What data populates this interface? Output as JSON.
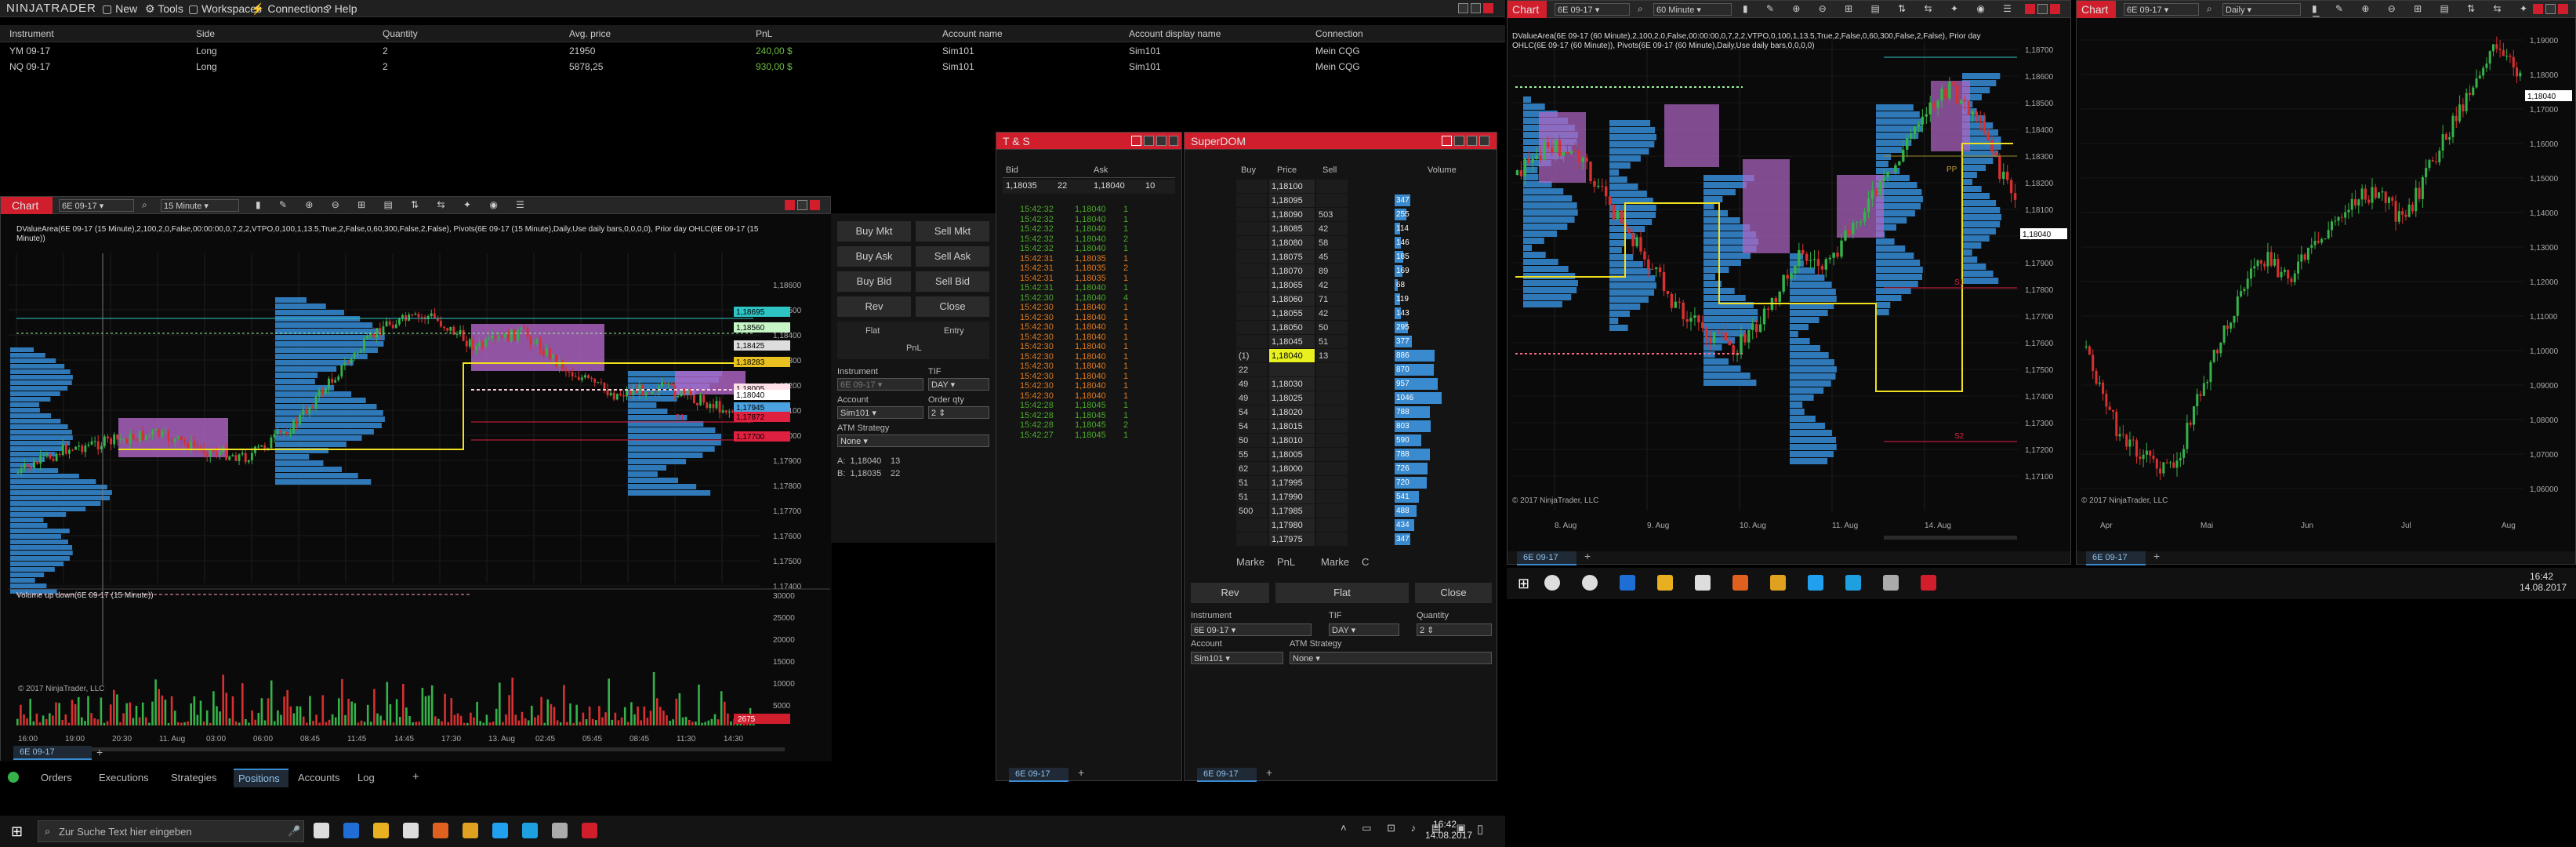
{
  "menu": {
    "logo": "NINJATRADER",
    "items": [
      "New",
      "Tools",
      "Workspaces",
      "Connections",
      "Help"
    ]
  },
  "positions": {
    "columns": [
      "Instrument",
      "Side",
      "Quantity",
      "Avg. price",
      "PnL",
      "Account name",
      "Account display name",
      "Connection"
    ],
    "rows": [
      [
        "YM 09-17",
        "Long",
        "2",
        "21950",
        "240,00 $",
        "Sim101",
        "Sim101",
        "Mein CQG"
      ],
      [
        "NQ 09-17",
        "Long",
        "2",
        "5878,25",
        "930,00 $",
        "Sim101",
        "Sim101",
        "Mein CQG"
      ]
    ]
  },
  "chart1": {
    "title": "Chart",
    "instrument": "6E 09-17",
    "interval": "15 Minute",
    "indicator_text": "DValueArea(6E 09-17 (15 Minute),2,100,2,0,False,00:00:00,0,7,2,2,VTPO,0,100,1,13.5,True,2,False,0,60,300,False,2,False), Pivots(6E 09-17 (15 Minute),Daily,Use daily bars,0,0,0,0), Prior day OHLC(6E 09-17 (15 Minute))",
    "price_ticks": [
      "1,18600",
      "1,18500",
      "1,18400",
      "1,18300",
      "1,18200",
      "1,18100",
      "1,18000",
      "1,17900",
      "1,17800",
      "1,17700",
      "1,17600",
      "1,17500",
      "1,17400"
    ],
    "price_labels": [
      {
        "text": "1,18695",
        "color": "#2ec4c4"
      },
      {
        "text": "1,18560",
        "color": "#c6f6c6"
      },
      {
        "text": "1,18425",
        "color": "#dddddd"
      },
      {
        "text": "1,18283",
        "color": "#e8c020"
      },
      {
        "text": "1,18005",
        "color": "#ffe0e8"
      },
      {
        "text": "1,18040",
        "color": "#ffffff"
      },
      {
        "text": "1,17945",
        "color": "#4aa3e0"
      },
      {
        "text": "1,17872",
        "color": "#e02040"
      },
      {
        "text": "1,17700",
        "color": "#e02040"
      }
    ],
    "time_ticks": [
      "16:00",
      "19:00",
      "20:30",
      "11. Aug",
      "03:00",
      "06:00",
      "08:45",
      "11:45",
      "14:45",
      "17:30",
      "13. Aug",
      "02:45",
      "05:45",
      "08:45",
      "11:30",
      "14:30"
    ],
    "volume_title": "Volume up down(6E 09-17 (15 Minute))",
    "volume_ticks": [
      "30000",
      "25000",
      "20000",
      "15000",
      "10000",
      "5000"
    ],
    "volume_label": "2675",
    "copyright": "© 2017 NinjaTrader, LLC",
    "tab": "6E 09-17",
    "markers": {
      "s1": "S1"
    }
  },
  "order_panel": {
    "buy_mkt": "Buy Mkt",
    "sell_mkt": "Sell Mkt",
    "buy_ask": "Buy Ask",
    "sell_ask": "Sell Ask",
    "buy_bid": "Buy Bid",
    "sell_bid": "Sell Bid",
    "rev": "Rev",
    "close": "Close",
    "flat": "Flat",
    "entry": "Entry",
    "pnl": "PnL",
    "instrument_label": "Instrument",
    "instrument_value": "6E 09-17",
    "tif_label": "TIF",
    "tif_value": "DAY",
    "account_label": "Account",
    "account_value": "Sim101",
    "order_qty_label": "Order qty",
    "order_qty_value": "2",
    "atm_label": "ATM Strategy",
    "atm_value": "None",
    "ask_label": "A:",
    "ask_price": "1,18040",
    "ask_size": "13",
    "bid_label": "B:",
    "bid_price": "1,18035",
    "bid_size": "22"
  },
  "ts": {
    "title": "T & S",
    "bid_label": "Bid",
    "ask_label": "Ask",
    "bid_price": "1,18035",
    "bid_size": "22",
    "ask_price": "1,18040",
    "ask_size": "10",
    "rows": [
      [
        "15:42:32",
        "1,18040",
        "1",
        "g"
      ],
      [
        "15:42:32",
        "1,18040",
        "1",
        "g"
      ],
      [
        "15:42:32",
        "1,18040",
        "1",
        "g"
      ],
      [
        "15:42:32",
        "1,18040",
        "2",
        "g"
      ],
      [
        "15:42:32",
        "1,18040",
        "1",
        "g"
      ],
      [
        "15:42:31",
        "1,18035",
        "1",
        "r"
      ],
      [
        "15:42:31",
        "1,18035",
        "2",
        "r"
      ],
      [
        "15:42:31",
        "1,18035",
        "1",
        "r"
      ],
      [
        "15:42:31",
        "1,18040",
        "1",
        "g"
      ],
      [
        "15:42:30",
        "1,18040",
        "4",
        "g"
      ],
      [
        "15:42:30",
        "1,18040",
        "1",
        "r"
      ],
      [
        "15:42:30",
        "1,18040",
        "1",
        "r"
      ],
      [
        "15:42:30",
        "1,18040",
        "1",
        "r"
      ],
      [
        "15:42:30",
        "1,18040",
        "1",
        "r"
      ],
      [
        "15:42:30",
        "1,18040",
        "1",
        "r"
      ],
      [
        "15:42:30",
        "1,18040",
        "1",
        "r"
      ],
      [
        "15:42:30",
        "1,18040",
        "1",
        "r"
      ],
      [
        "15:42:30",
        "1,18040",
        "1",
        "r"
      ],
      [
        "15:42:30",
        "1,18040",
        "1",
        "r"
      ],
      [
        "15:42:30",
        "1,18040",
        "1",
        "r"
      ],
      [
        "15:42:28",
        "1,18045",
        "1",
        "g"
      ],
      [
        "15:42:28",
        "1,18045",
        "1",
        "g"
      ],
      [
        "15:42:28",
        "1,18045",
        "2",
        "g"
      ],
      [
        "15:42:27",
        "1,18045",
        "1",
        "g"
      ]
    ],
    "tab": "6E 09-17"
  },
  "dom": {
    "title": "SuperDOM",
    "col_buy": "Buy",
    "col_price": "Price",
    "col_sell": "Sell",
    "col_volume": "Volume",
    "rows": [
      [
        "",
        "1,18100",
        "",
        ""
      ],
      [
        "",
        "1,18095",
        "",
        "347"
      ],
      [
        "",
        "1,18090",
        "503",
        "255"
      ],
      [
        "",
        "1,18085",
        "42",
        "114"
      ],
      [
        "",
        "1,18080",
        "58",
        "146"
      ],
      [
        "",
        "1,18075",
        "45",
        "185"
      ],
      [
        "",
        "1,18070",
        "89",
        "169"
      ],
      [
        "",
        "1,18065",
        "42",
        "68"
      ],
      [
        "",
        "1,18060",
        "71",
        "119"
      ],
      [
        "",
        "1,18055",
        "42",
        "143"
      ],
      [
        "",
        "1,18050",
        "50",
        "295"
      ],
      [
        "",
        "1,18045",
        "51",
        "377"
      ],
      [
        "(1)",
        "1,18040",
        "13",
        "886"
      ],
      [
        "22",
        "",
        "",
        "870"
      ],
      [
        "49",
        "1,18030",
        "",
        "957"
      ],
      [
        "49",
        "1,18025",
        "",
        "1046"
      ],
      [
        "54",
        "1,18020",
        "",
        "788"
      ],
      [
        "54",
        "1,18015",
        "",
        "803"
      ],
      [
        "50",
        "1,18010",
        "",
        "590"
      ],
      [
        "55",
        "1,18005",
        "",
        "788"
      ],
      [
        "62",
        "1,18000",
        "",
        "726"
      ],
      [
        "51",
        "1,17995",
        "",
        "720"
      ],
      [
        "51",
        "1,17990",
        "",
        "541"
      ],
      [
        "500",
        "1,17985",
        "",
        "488"
      ],
      [
        "",
        "1,17980",
        "",
        "434"
      ],
      [
        "",
        "1,17975",
        "",
        "347"
      ]
    ],
    "volume_values": [
      0,
      347,
      255,
      114,
      146,
      185,
      169,
      68,
      119,
      143,
      295,
      377,
      886,
      870,
      957,
      1046,
      788,
      803,
      590,
      788,
      726,
      720,
      541,
      488,
      434,
      347
    ],
    "footer_market": "Marke",
    "footer_pnl": "PnL",
    "footer_market2": "Marke",
    "footer_c": "C",
    "rev": "Rev",
    "flat": "Flat",
    "close": "Close",
    "instrument_label": "Instrument",
    "instrument_value": "6E 09-17",
    "tif_label": "TIF",
    "tif_value": "DAY",
    "qty_label": "Quantity",
    "qty_value": "2",
    "account_label": "Account",
    "account_value": "Sim101",
    "atm_label": "ATM Strategy",
    "atm_value": "None",
    "tab": "6E 09-17"
  },
  "chart2": {
    "title": "Chart",
    "instrument": "6E 09-17",
    "interval": "60 Minute",
    "indicator_text": "DValueArea(6E 09-17 (60 Minute),2,100,2,0,False,00:00:00,0,7,2,2,VTPO,0,100,1,13.5,True,2,False,0,60,300,False,2,False), Prior day OHLC(6E 09-17 (60 Minute)), Pivots(6E 09-17 (60 Minute),Daily,Use daily bars,0,0,0,0)",
    "price_ticks": [
      "1,18700",
      "1,18600",
      "1,18500",
      "1,18400",
      "1,18300",
      "1,18200",
      "1,18100",
      "1,18000",
      "1,17900",
      "1,17800",
      "1,17700",
      "1,17600",
      "1,17500",
      "1,17400",
      "1,17300",
      "1,17200",
      "1,17100"
    ],
    "current_price": "1,18040",
    "time_ticks": [
      "8. Aug",
      "9. Aug",
      "10. Aug",
      "11. Aug",
      "14. Aug"
    ],
    "copyright": "© 2017 NinjaTrader, LLC",
    "tab": "6E 09-17",
    "markers": {
      "pp": "PP",
      "r1": "R1",
      "s1": "S1",
      "s2": "S2"
    }
  },
  "chart3": {
    "title": "Chart",
    "instrument": "6E 09-17",
    "interval": "Daily",
    "price_ticks": [
      "1,19000",
      "1,18000",
      "1,17000",
      "1,16000",
      "1,15000",
      "1,14000",
      "1,13000",
      "1,12000",
      "1,11000",
      "1,10000",
      "1,09000",
      "1,08000",
      "1,07000",
      "1,06000"
    ],
    "current_price": "1,18040",
    "time_ticks": [
      "Apr",
      "Mai",
      "Jun",
      "Jul",
      "Aug"
    ],
    "copyright": "© 2017 NinjaTrader, LLC",
    "tab": "6E 09-17"
  },
  "bottom_tabs": [
    "Orders",
    "Executions",
    "Strategies",
    "Positions",
    "Accounts",
    "Log"
  ],
  "taskbar_left": {
    "search_placeholder": "Zur Suche Text hier eingeben",
    "time": "16:42",
    "date": "14.08.2017"
  },
  "taskbar_right": {
    "time": "16:42",
    "date": "14.08.2017"
  },
  "colors": {
    "bg": "#000000",
    "panel": "#141414",
    "up": "#35b24a",
    "down": "#d83030",
    "profile": "#3a8ad0",
    "tpo": "#b266c8",
    "yellow": "#f0e020",
    "red_btn": "#d01e2c"
  }
}
